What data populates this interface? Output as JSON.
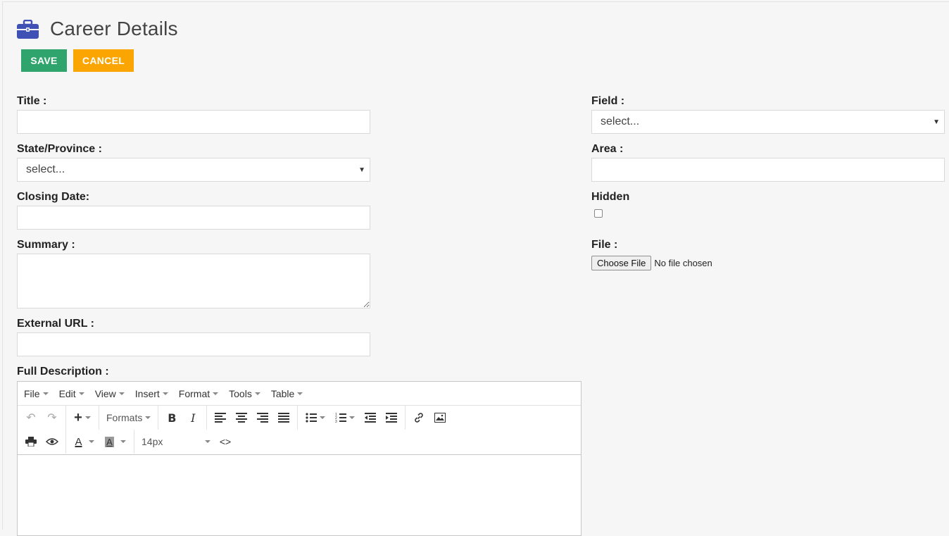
{
  "header": {
    "title": "Career Details",
    "icon": "briefcase-icon",
    "icon_color": "#3f51b5"
  },
  "actions": {
    "save_label": "SAVE",
    "cancel_label": "CANCEL",
    "save_color": "#2fa56d",
    "cancel_color": "#fba503"
  },
  "form": {
    "title_label": "Title :",
    "title_value": "",
    "state_label": "State/Province :",
    "state_value": "select...",
    "closing_date_label": "Closing Date:",
    "closing_date_value": "",
    "summary_label": "Summary :",
    "summary_value": "",
    "external_url_label": "External URL :",
    "external_url_value": "",
    "full_description_label": "Full Description :",
    "field_label": "Field :",
    "field_value": "select...",
    "area_label": "Area :",
    "area_value": "",
    "hidden_label": "Hidden",
    "hidden_checked": false,
    "file_label": "File :",
    "file_button": "Choose File",
    "file_status": "No file chosen"
  },
  "editor": {
    "menus": [
      "File",
      "Edit",
      "View",
      "Insert",
      "Format",
      "Tools",
      "Table"
    ],
    "formats_label": "Formats",
    "font_size": "14px"
  }
}
